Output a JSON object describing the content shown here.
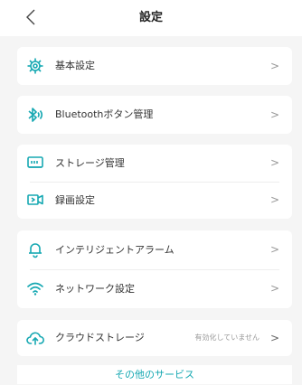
{
  "header": {
    "title": "設定",
    "back_icon": "chevron-left-icon"
  },
  "theme": {
    "accent": "#16a8b2",
    "background": "#f5f5f5",
    "card": "#ffffff",
    "chevron": "#999999"
  },
  "chevron_glyph": ">",
  "sections": [
    {
      "items": [
        {
          "label": "基本設定",
          "icon": "gear-icon"
        }
      ]
    },
    {
      "items": [
        {
          "label": "Bluetoothボタン管理",
          "icon": "bluetooth-icon"
        }
      ]
    },
    {
      "items": [
        {
          "label": "ストレージ管理",
          "icon": "storage-icon"
        },
        {
          "label": "録画設定",
          "icon": "video-camera-icon"
        }
      ]
    },
    {
      "items": [
        {
          "label": "インテリジェントアラーム",
          "icon": "bell-icon"
        },
        {
          "label": "ネットワーク設定",
          "icon": "wifi-icon"
        }
      ]
    },
    {
      "items": [
        {
          "label": "クラウドストレージ",
          "icon": "cloud-upload-icon",
          "status": "有効化していません"
        }
      ]
    }
  ],
  "footer": {
    "more_services": "その他のサービス"
  }
}
